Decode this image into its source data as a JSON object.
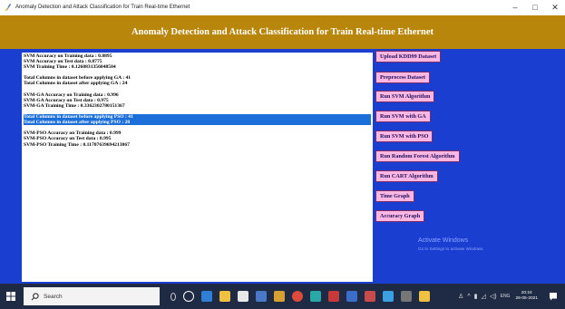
{
  "window": {
    "title": "Anomaly Detection and Attack Classification for Train Real-time Ethernet",
    "minimize": "–",
    "maximize": "□",
    "close": "✕"
  },
  "header": {
    "title": "Anomaly Detection and Attack Classification for Train Real-time Ethernet",
    "bg_color": "#b8860b"
  },
  "output": {
    "lines": [
      "SVM Accuracy on Training data : 0.8895",
      "SVM Accuracy on Test data : 0.8775",
      "SVM Training Time : 0.1260831356048584",
      "",
      "Total Columns in dataset before applying GA : 41",
      "Total Columns in dataset after applying GA : 24",
      "",
      "SVM-GA Accuracy on Training data : 0.996",
      "SVM-GA Accuracy on Test data : 0.975",
      "SVM-GA Training Time : 0.3362302780151367",
      "",
      "Total Columns in dataset before applying PSO : 41",
      "Total Columns in dataset after applying PSO : 20",
      "",
      "SVM-PSO Accuracy on Training data : 0.999",
      "SVM-PSO Accuracy on Test data : 0.995",
      "SVM-PSO Training Time : 0.11707639694213867"
    ]
  },
  "buttons": {
    "upload": "Upload KDD99 Dataset",
    "preprocess": "Preprocess Dataset",
    "run_svm": "Run SVM Algorithm",
    "run_svm_ga": "Run SVM with GA",
    "run_svm_pso": "Run SVM with PSO",
    "run_rf": "Run Random Forest Algorithm",
    "run_cart": "Run CART Algorithm",
    "time_graph": "Time Graph",
    "accuracy_graph": "Accuracy Graph"
  },
  "watermark": {
    "line1": "Activate Windows",
    "line2": "Go to Settings to activate Windows."
  },
  "taskbar": {
    "search_placeholder": "Search",
    "clock_time": "20:24",
    "clock_date": "26-05-2021",
    "tray_lang": "ENG"
  },
  "colors": {
    "main_bg": "#1a3fd0",
    "button_bg": "#ffb6e1",
    "selection": "#1c6fd9"
  }
}
